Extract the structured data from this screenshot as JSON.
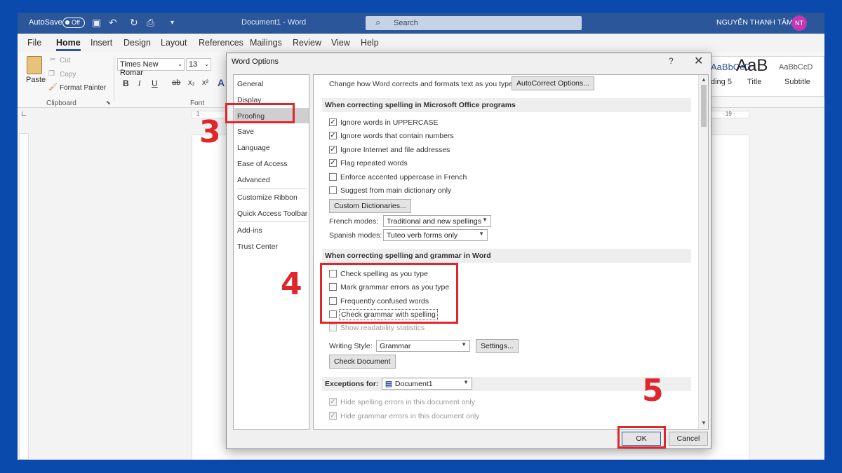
{
  "titlebar": {
    "autosave": "AutoSave",
    "autosave_state": "Off",
    "doc_title": "Document1  -  Word",
    "search_placeholder": "Search",
    "user": "NGUYỄN THANH TÂM",
    "avatar": "NT"
  },
  "menu": [
    "File",
    "Home",
    "Insert",
    "Design",
    "Layout",
    "References",
    "Mailings",
    "Review",
    "View",
    "Help"
  ],
  "ribbon": {
    "paste": "Paste",
    "cut": "Cut",
    "copy": "Copy",
    "format_painter": "Format Painter",
    "clipboard": "Clipboard",
    "font_name": "Times New Romar",
    "font_size": "13",
    "font_group": "Font",
    "styles": [
      {
        "preview": "AaBbCcD",
        "label": "ding 5"
      },
      {
        "preview": "AaB",
        "label": "Title"
      },
      {
        "preview": "AaBbCcD",
        "label": "Subtitle"
      }
    ]
  },
  "ruler": {
    "left": "· 1 ·",
    "right": "· 19 ·"
  },
  "dialog": {
    "title": "Word Options",
    "help": "?",
    "close": "✕",
    "nav": [
      "General",
      "Display",
      "Proofing",
      "Save",
      "Language",
      "Ease of Access",
      "Advanced",
      "Customize Ribbon",
      "Quick Access Toolbar",
      "Add-ins",
      "Trust Center"
    ],
    "autocorrect_text": "Change how Word corrects and formats text as you type:",
    "autocorrect_btn": "AutoCorrect Options...",
    "sec_office": "When correcting spelling in Microsoft Office programs",
    "office_opts": [
      {
        "label": "Ignore words in UPPERCASE",
        "checked": "✓"
      },
      {
        "label": "Ignore words that contain numbers",
        "checked": "✓"
      },
      {
        "label": "Ignore Internet and file addresses",
        "checked": "✓"
      },
      {
        "label": "Flag repeated words",
        "checked": "✓"
      },
      {
        "label": "Enforce accented uppercase in French",
        "checked": ""
      },
      {
        "label": "Suggest from main dictionary only",
        "checked": ""
      }
    ],
    "custom_dict_btn": "Custom Dictionaries...",
    "french_label": "French modes:",
    "french_value": "Traditional and new spellings",
    "spanish_label": "Spanish modes:",
    "spanish_value": "Tuteo verb forms only",
    "sec_word": "When correcting spelling and grammar in Word",
    "word_opts": [
      "Check spelling as you type",
      "Mark grammar errors as you type",
      "Frequently confused words",
      "Check grammar with spelling"
    ],
    "readability": "Show readability statistics",
    "writing_style_label": "Writing Style:",
    "writing_style_value": "Grammar",
    "settings_btn": "Settings...",
    "check_doc_btn": "Check Document",
    "exceptions_label": "Exceptions for:",
    "exceptions_value": "Document1",
    "hide_spelling": "Hide spelling errors in this document only",
    "hide_grammar": "Hide grammar errors in this document only",
    "ok": "OK",
    "cancel": "Cancel"
  },
  "steps": [
    "3",
    "4",
    "5"
  ],
  "colors": {
    "word_blue": "#2b579a",
    "frame_blue": "#0a4aad",
    "annotation_red": "#e0262a"
  }
}
